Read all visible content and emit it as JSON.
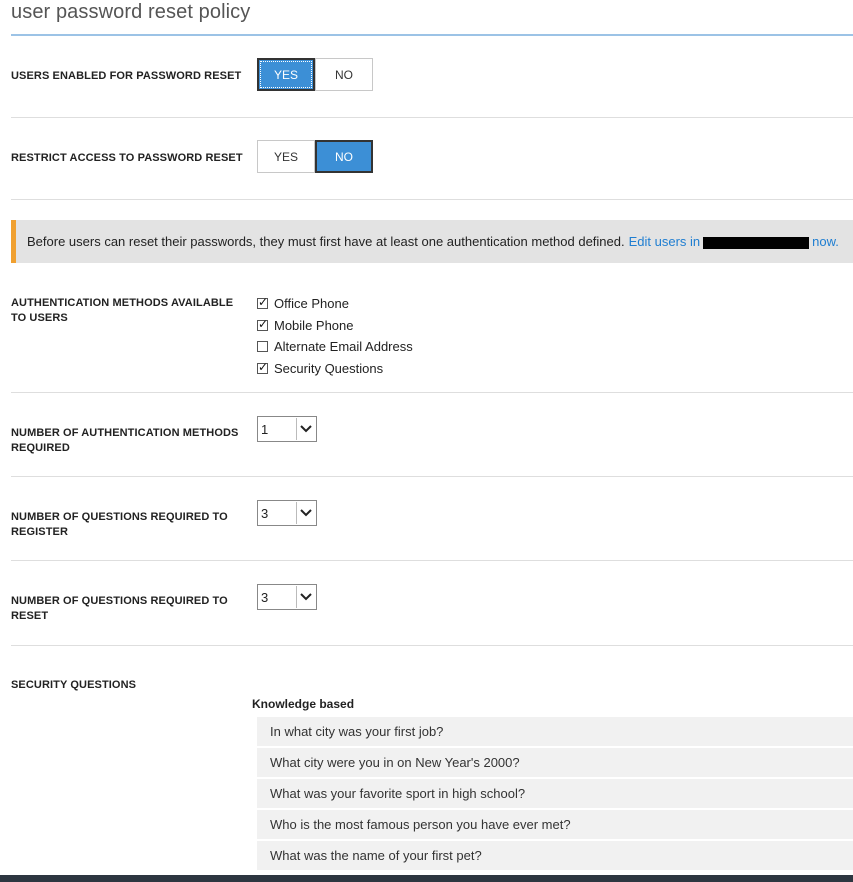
{
  "page": {
    "title": "user password reset policy"
  },
  "settings": {
    "users_enabled": {
      "label": "USERS ENABLED FOR PASSWORD RESET",
      "yes": "YES",
      "no": "NO",
      "selected": "YES"
    },
    "restrict_access": {
      "label": "RESTRICT ACCESS TO PASSWORD RESET",
      "yes": "YES",
      "no": "NO",
      "selected": "NO"
    }
  },
  "info_bar": {
    "text": "Before users can reset their passwords, they must first have at least one authentication method defined.",
    "link_prefix": "Edit users in",
    "link_suffix": "now.",
    "accent_color": "#f0a030"
  },
  "auth_methods": {
    "label": "AUTHENTICATION METHODS AVAILABLE TO USERS",
    "options": [
      {
        "label": "Office Phone",
        "checked": true
      },
      {
        "label": "Mobile Phone",
        "checked": true
      },
      {
        "label": "Alternate Email Address",
        "checked": false
      },
      {
        "label": "Security Questions",
        "checked": true
      }
    ]
  },
  "methods_required": {
    "label": "NUMBER OF AUTHENTICATION METHODS REQUIRED",
    "value": "1"
  },
  "questions_register": {
    "label": "NUMBER OF QUESTIONS REQUIRED TO REGISTER",
    "value": "3"
  },
  "questions_reset": {
    "label": "NUMBER OF QUESTIONS REQUIRED TO RESET",
    "value": "3"
  },
  "security_questions": {
    "label": "SECURITY QUESTIONS",
    "group_label": "Knowledge based",
    "items": [
      "In what city was your first job?",
      "What city were you in on New Year's 2000?",
      "What was your favorite sport in high school?",
      "Who is the most famous person you have ever met?",
      "What was the name of your first pet?"
    ]
  },
  "colors": {
    "accent": "#3c8fd6",
    "link": "#1f7ed1",
    "title_rule": "#9cc3e6"
  }
}
